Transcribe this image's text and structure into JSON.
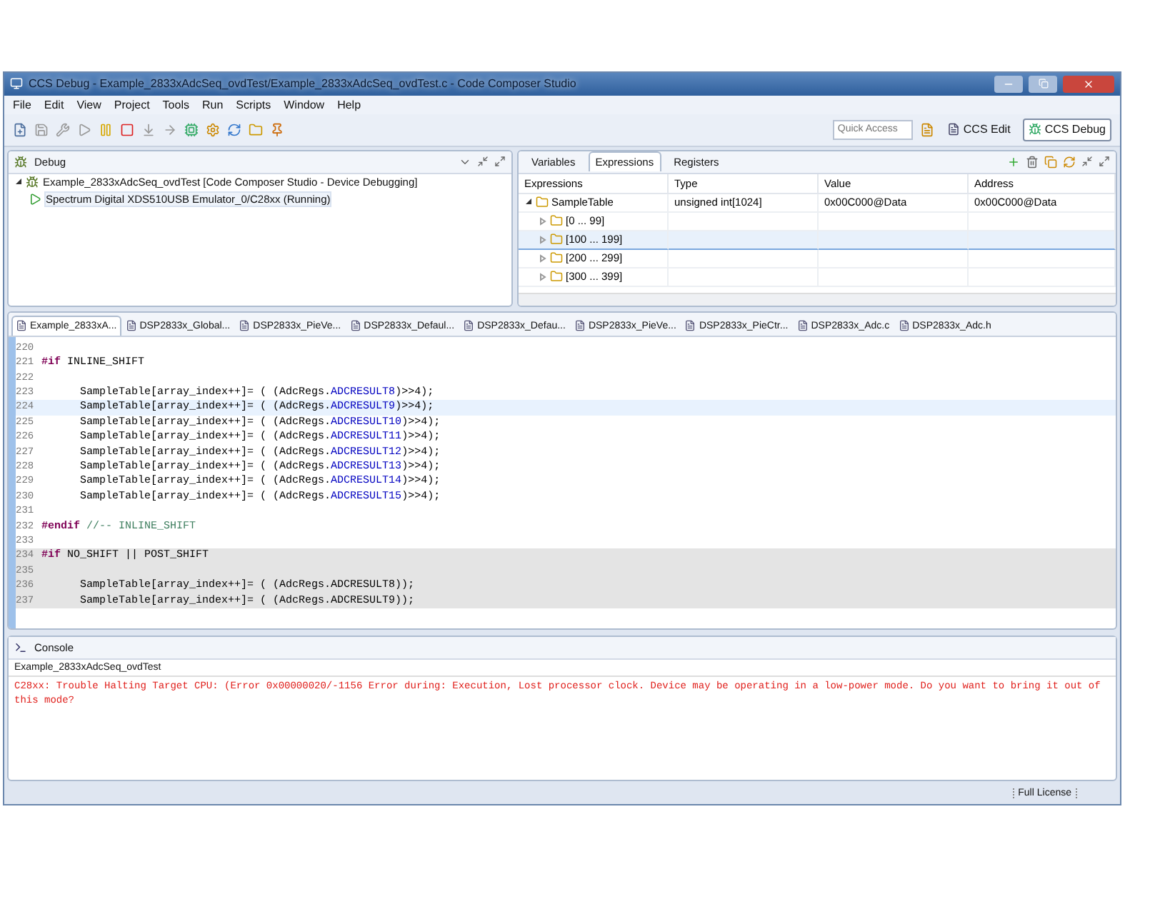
{
  "window": {
    "title": "CCS Debug - Example_2833xAdcSeq_ovdTest/Example_2833xAdcSeq_ovdTest.c - Code Composer Studio"
  },
  "menu": [
    "File",
    "Edit",
    "View",
    "Project",
    "Tools",
    "Run",
    "Scripts",
    "Window",
    "Help"
  ],
  "quick_access": {
    "placeholder": "Quick Access"
  },
  "perspectives": [
    {
      "label": "CCS Edit",
      "selected": false
    },
    {
      "label": "CCS Debug",
      "selected": true
    }
  ],
  "debug_view": {
    "title": "Debug",
    "tree": [
      {
        "label": "Example_2833xAdcSeq_ovdTest [Code Composer Studio - Device Debugging]",
        "expanded": true,
        "children": [
          {
            "label": "Spectrum Digital XDS510USB Emulator_0/C28xx (Running)",
            "selected": true
          }
        ]
      }
    ]
  },
  "expressions_view": {
    "tabs": [
      {
        "label": "Variables",
        "selected": false
      },
      {
        "label": "Expressions",
        "selected": true
      },
      {
        "label": "Registers",
        "selected": false
      }
    ],
    "columns": [
      "Expressions",
      "Type",
      "Value",
      "Address"
    ],
    "rows": [
      {
        "name": "SampleTable",
        "type": "unsigned int[1024]",
        "value": "0x00C000@Data",
        "address": "0x00C000@Data",
        "expanded": true,
        "children": [
          {
            "name": "[0 ... 99]",
            "selected": false
          },
          {
            "name": "[100 ... 199]",
            "selected": true
          },
          {
            "name": "[200 ... 299]",
            "selected": false
          },
          {
            "name": "[300 ... 399]",
            "selected": false
          }
        ]
      }
    ]
  },
  "editor": {
    "tabs": [
      {
        "label": "Example_2833xA...",
        "selected": true
      },
      {
        "label": "DSP2833x_Global...",
        "selected": false
      },
      {
        "label": "DSP2833x_PieVe...",
        "selected": false
      },
      {
        "label": "DSP2833x_Defaul...",
        "selected": false
      },
      {
        "label": "DSP2833x_Defau...",
        "selected": false
      },
      {
        "label": "DSP2833x_PieVe...",
        "selected": false
      },
      {
        "label": "DSP2833x_PieCtr...",
        "selected": false
      },
      {
        "label": "DSP2833x_Adc.c",
        "selected": false
      },
      {
        "label": "DSP2833x_Adc.h",
        "selected": false
      }
    ],
    "lines": [
      {
        "number": "220",
        "current": false,
        "inactive": false
      },
      {
        "number": "221",
        "current": false,
        "inactive": false,
        "segments": [
          {
            "kind": "keyword",
            "text": "#if"
          },
          {
            "kind": "plain",
            "text": " INLINE_SHIFT"
          }
        ]
      },
      {
        "number": "222",
        "current": false,
        "inactive": false
      },
      {
        "number": "223",
        "current": false,
        "inactive": false,
        "segments": [
          {
            "kind": "plain",
            "text": "      SampleTable[array_index++]= ( (AdcRegs."
          },
          {
            "kind": "field",
            "text": "ADCRESULT8"
          },
          {
            "kind": "plain",
            "text": ")>>4);"
          }
        ]
      },
      {
        "number": "224",
        "current": true,
        "inactive": false,
        "segments": [
          {
            "kind": "plain",
            "text": "      SampleTable[array_index++]= ( (AdcRegs."
          },
          {
            "kind": "field",
            "text": "ADCRESULT9"
          },
          {
            "kind": "plain",
            "text": ")>>4);"
          }
        ]
      },
      {
        "number": "225",
        "current": false,
        "inactive": false,
        "segments": [
          {
            "kind": "plain",
            "text": "      SampleTable[array_index++]= ( (AdcRegs."
          },
          {
            "kind": "field",
            "text": "ADCRESULT10"
          },
          {
            "kind": "plain",
            "text": ")>>4);"
          }
        ]
      },
      {
        "number": "226",
        "current": false,
        "inactive": false,
        "segments": [
          {
            "kind": "plain",
            "text": "      SampleTable[array_index++]= ( (AdcRegs."
          },
          {
            "kind": "field",
            "text": "ADCRESULT11"
          },
          {
            "kind": "plain",
            "text": ")>>4);"
          }
        ]
      },
      {
        "number": "227",
        "current": false,
        "inactive": false,
        "segments": [
          {
            "kind": "plain",
            "text": "      SampleTable[array_index++]= ( (AdcRegs."
          },
          {
            "kind": "field",
            "text": "ADCRESULT12"
          },
          {
            "kind": "plain",
            "text": ")>>4);"
          }
        ]
      },
      {
        "number": "228",
        "current": false,
        "inactive": false,
        "segments": [
          {
            "kind": "plain",
            "text": "      SampleTable[array_index++]= ( (AdcRegs."
          },
          {
            "kind": "field",
            "text": "ADCRESULT13"
          },
          {
            "kind": "plain",
            "text": ")>>4);"
          }
        ]
      },
      {
        "number": "229",
        "current": false,
        "inactive": false,
        "segments": [
          {
            "kind": "plain",
            "text": "      SampleTable[array_index++]= ( (AdcRegs."
          },
          {
            "kind": "field",
            "text": "ADCRESULT14"
          },
          {
            "kind": "plain",
            "text": ")>>4);"
          }
        ]
      },
      {
        "number": "230",
        "current": false,
        "inactive": false,
        "segments": [
          {
            "kind": "plain",
            "text": "      SampleTable[array_index++]= ( (AdcRegs."
          },
          {
            "kind": "field",
            "text": "ADCRESULT15"
          },
          {
            "kind": "plain",
            "text": ")>>4);"
          }
        ]
      },
      {
        "number": "231",
        "current": false,
        "inactive": false
      },
      {
        "number": "232",
        "current": false,
        "inactive": false,
        "segments": [
          {
            "kind": "keyword",
            "text": "#endif"
          },
          {
            "kind": "comment",
            "text": " //-- INLINE_SHIFT"
          }
        ]
      },
      {
        "number": "233",
        "current": false,
        "inactive": false
      },
      {
        "number": "234",
        "current": false,
        "inactive": true,
        "segments": [
          {
            "kind": "keyword",
            "text": "#if"
          },
          {
            "kind": "plain",
            "text": " NO_SHIFT || POST_SHIFT"
          }
        ]
      },
      {
        "number": "235",
        "current": false,
        "inactive": true
      },
      {
        "number": "236",
        "current": false,
        "inactive": true,
        "segments": [
          {
            "kind": "plain",
            "text": "      SampleTable[array_index++]= ( (AdcRegs.ADCRESULT8));"
          }
        ]
      },
      {
        "number": "237",
        "current": false,
        "inactive": true,
        "segments": [
          {
            "kind": "plain",
            "text": "      SampleTable[array_index++]= ( (AdcRegs.ADCRESULT9));"
          }
        ]
      }
    ]
  },
  "console": {
    "title": "Console",
    "subtitle": "Example_2833xAdcSeq_ovdTest",
    "message": "C28xx: Trouble Halting Target CPU: (Error 0x00000020/-1156 Error during: Execution,  Lost processor clock. Device may be operating in a low-power mode.  Do you want to bring it out of this mode?"
  },
  "status_bar": {
    "license": "Full License"
  }
}
